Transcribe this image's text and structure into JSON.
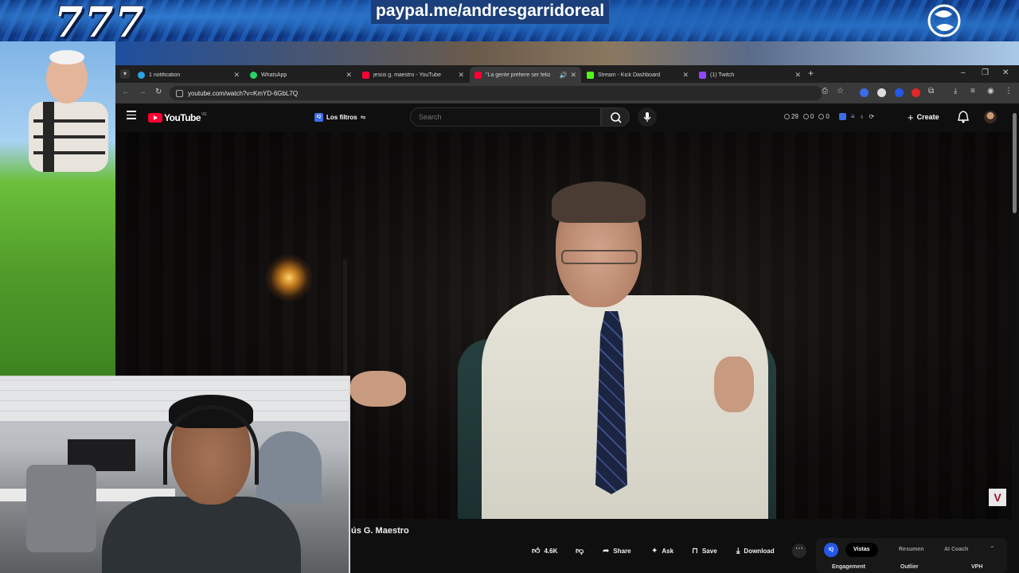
{
  "overlay": {
    "banner_number": "777",
    "banner_link": "paypal.me/andresgarridoreal"
  },
  "browser": {
    "tabs": [
      {
        "label": "1 notification",
        "icon": "telegram-icon",
        "color": "#2aa3e0"
      },
      {
        "label": "WhatsApp",
        "icon": "whatsapp-icon",
        "color": "#25d366"
      },
      {
        "label": "jesús g. maestro - YouTube",
        "icon": "youtube-icon",
        "color": "#ff0033"
      },
      {
        "label": "\"La gente prefiere ser feliz",
        "icon": "youtube-icon",
        "color": "#ff0033",
        "active": true,
        "playing_audio": true
      },
      {
        "label": "Stream - Kick Dashboard",
        "icon": "kick-icon",
        "color": "#53fc18"
      },
      {
        "label": "(1) Twitch",
        "icon": "twitch-icon",
        "color": "#9146ff"
      }
    ],
    "url": "youtube.com/watch?v=KmYD-6GbL7Q"
  },
  "youtube": {
    "logo_text": "YouTube",
    "logo_country": "VE",
    "filters_label": "Los filtros",
    "search_placeholder": "Search",
    "stats": {
      "clock": "29",
      "views": "0",
      "circle": "0"
    },
    "create_label": "Create",
    "channel_name": "ús G. Maestro",
    "actions": {
      "likes": "4.6K",
      "share": "Share",
      "ask": "Ask",
      "save": "Save",
      "download": "Download"
    },
    "vidiq": {
      "logo": "IQ",
      "tabs": [
        "Vistas",
        "Resumen",
        "AI Coach"
      ],
      "active_tab": "Vistas",
      "metrics": [
        "Engagement",
        "Outlier",
        "VPH"
      ]
    }
  },
  "colors": {
    "youtube_red": "#ff0033",
    "vidiq_blue": "#2458e6",
    "background": "#0f0f0f"
  }
}
